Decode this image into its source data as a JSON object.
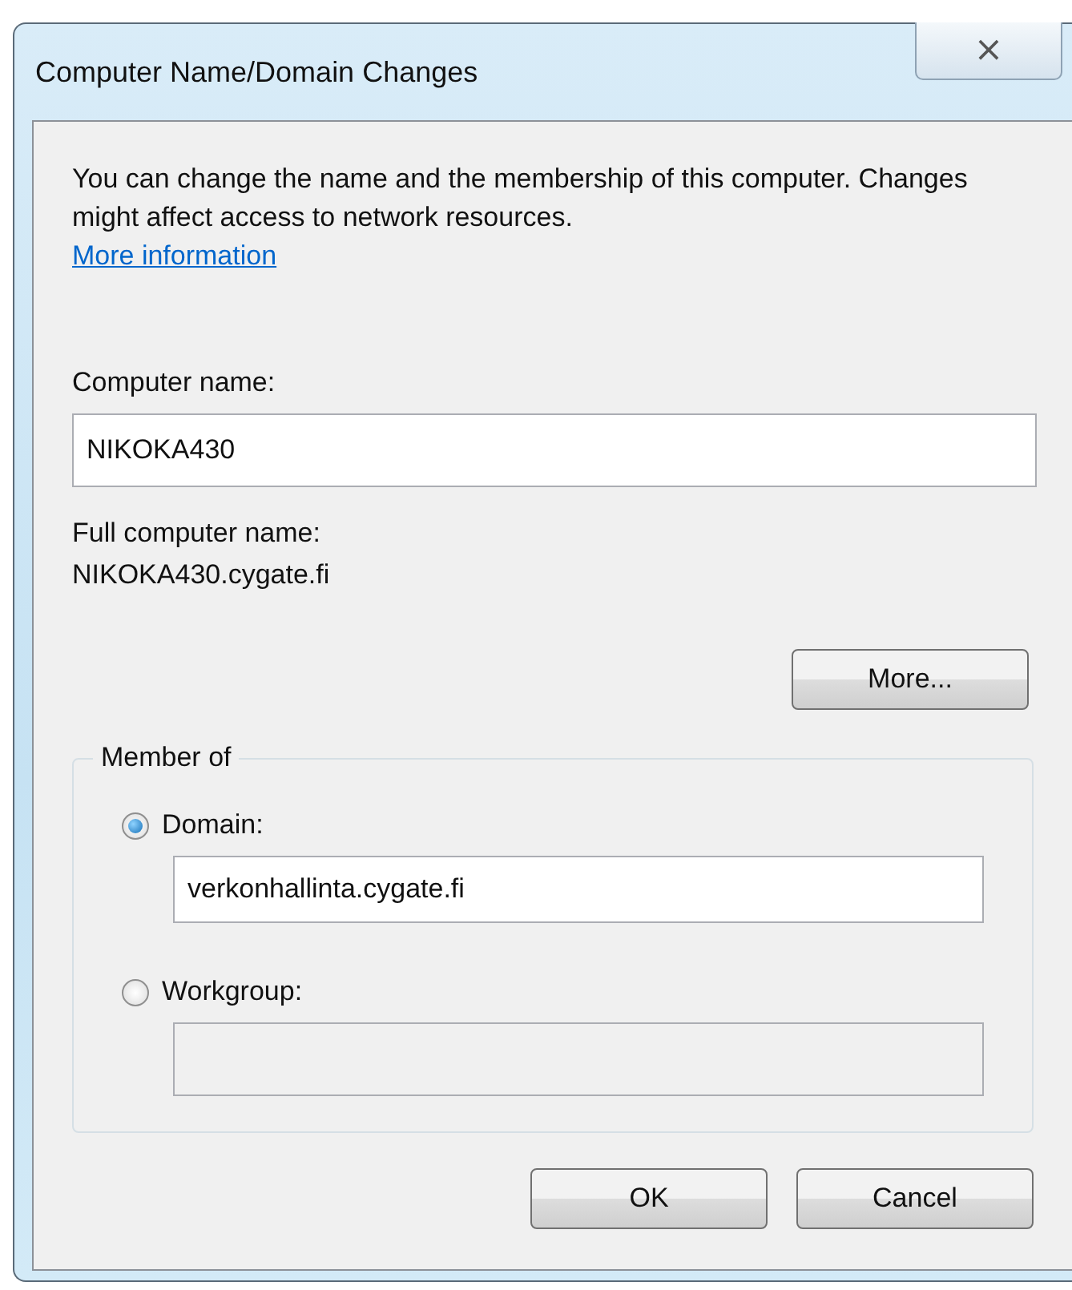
{
  "window": {
    "title": "Computer Name/Domain Changes",
    "close": "⨯"
  },
  "description": "You can change the name and the membership of this computer. Changes might affect access to network resources.",
  "more_info_link": "More information",
  "computer_name": {
    "label": "Computer name:",
    "value": "NIKOKA430"
  },
  "full_computer_name": {
    "label": "Full computer name:",
    "value": "NIKOKA430.cygate.fi"
  },
  "more_button": "More...",
  "member_of": {
    "legend": "Member of",
    "options": [
      {
        "label": "Domain:",
        "selected": true,
        "value": "verkonhallinta.cygate.fi",
        "disabled": false
      },
      {
        "label": "Workgroup:",
        "selected": false,
        "disabled": true
      }
    ]
  },
  "buttons": [
    "OK",
    "Cancel"
  ]
}
